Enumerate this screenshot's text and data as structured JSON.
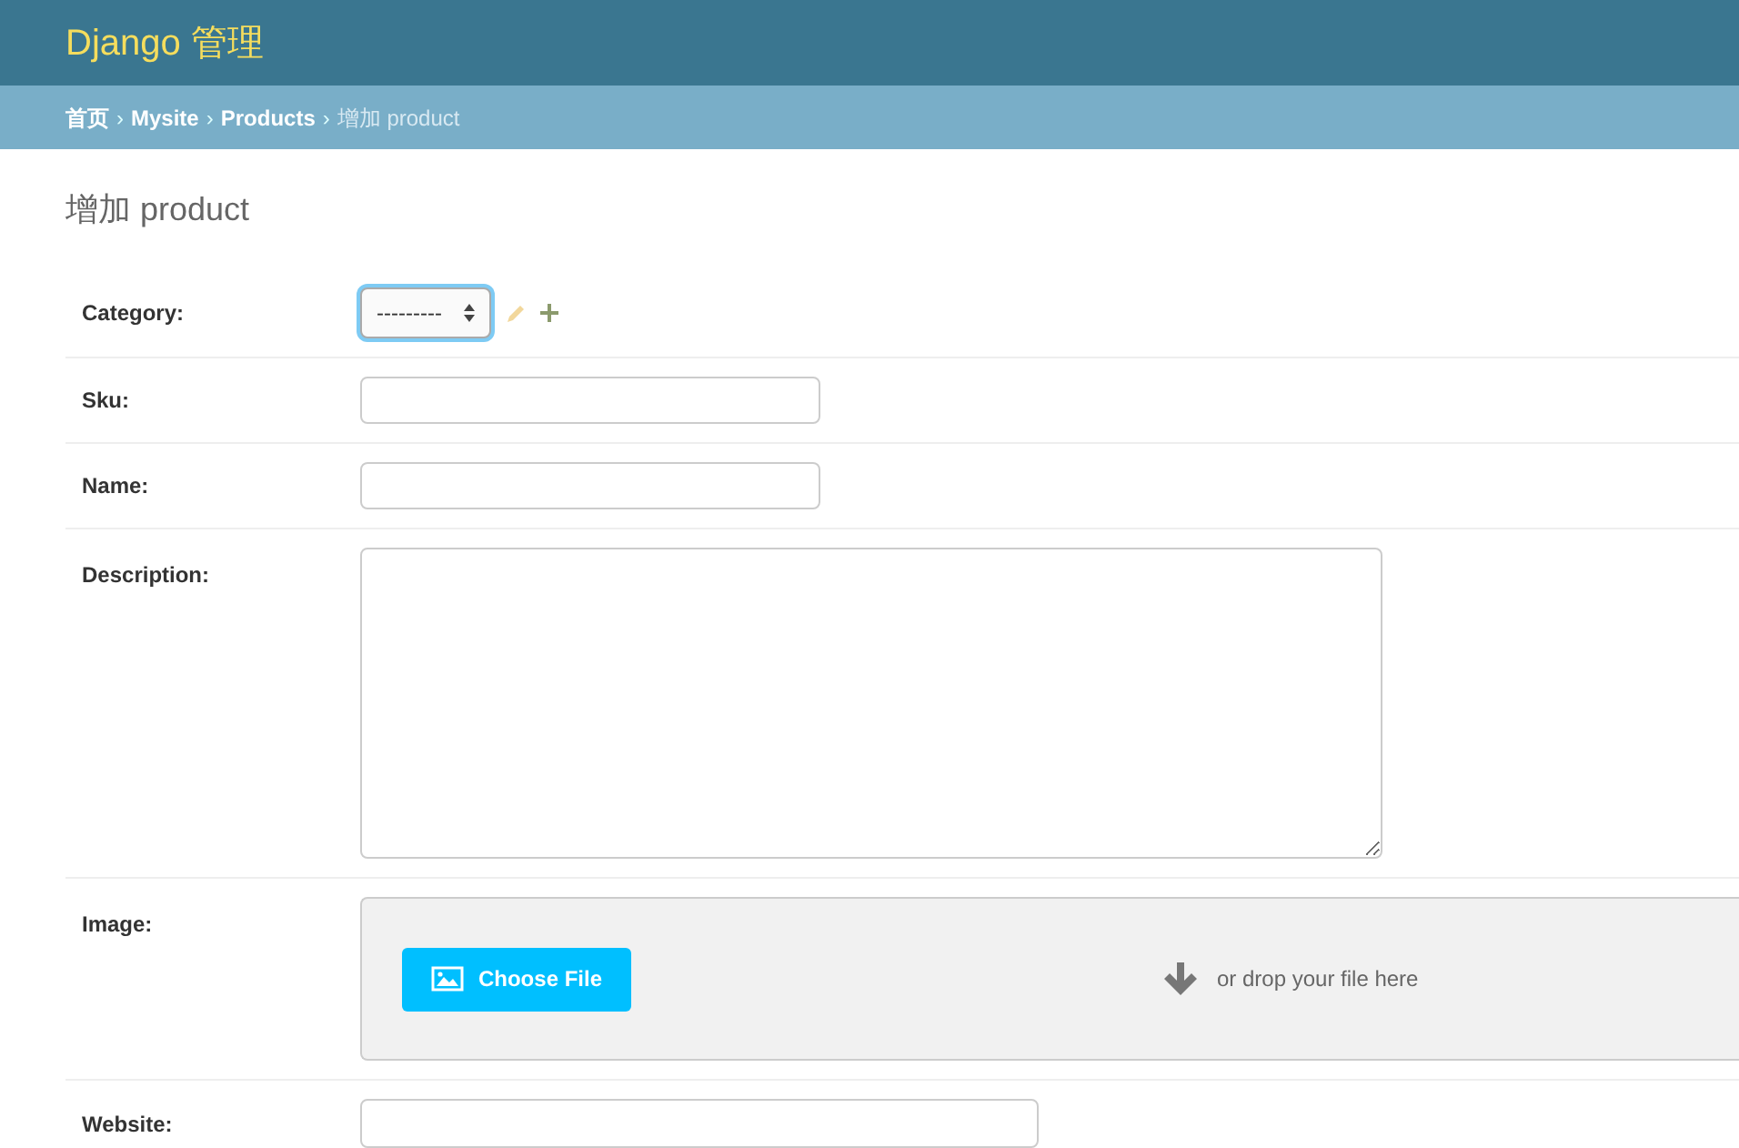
{
  "header": {
    "title": "Django 管理"
  },
  "breadcrumbs": {
    "separator": "›",
    "items": [
      {
        "label": "首页",
        "current": false
      },
      {
        "label": "Mysite",
        "current": false
      },
      {
        "label": "Products",
        "current": false
      },
      {
        "label": "增加 product",
        "current": true
      }
    ]
  },
  "page_title": "增加 product",
  "fields": [
    {
      "kind": "select",
      "label": "Category:",
      "value": "---------"
    },
    {
      "kind": "input",
      "label": "Sku:"
    },
    {
      "kind": "input",
      "label": "Name:"
    },
    {
      "kind": "textarea",
      "label": "Description:"
    },
    {
      "kind": "file",
      "label": "Image:",
      "button": "Choose File",
      "drop_text": "or drop your file here"
    },
    {
      "kind": "wide_input",
      "label": "Website:"
    }
  ]
}
